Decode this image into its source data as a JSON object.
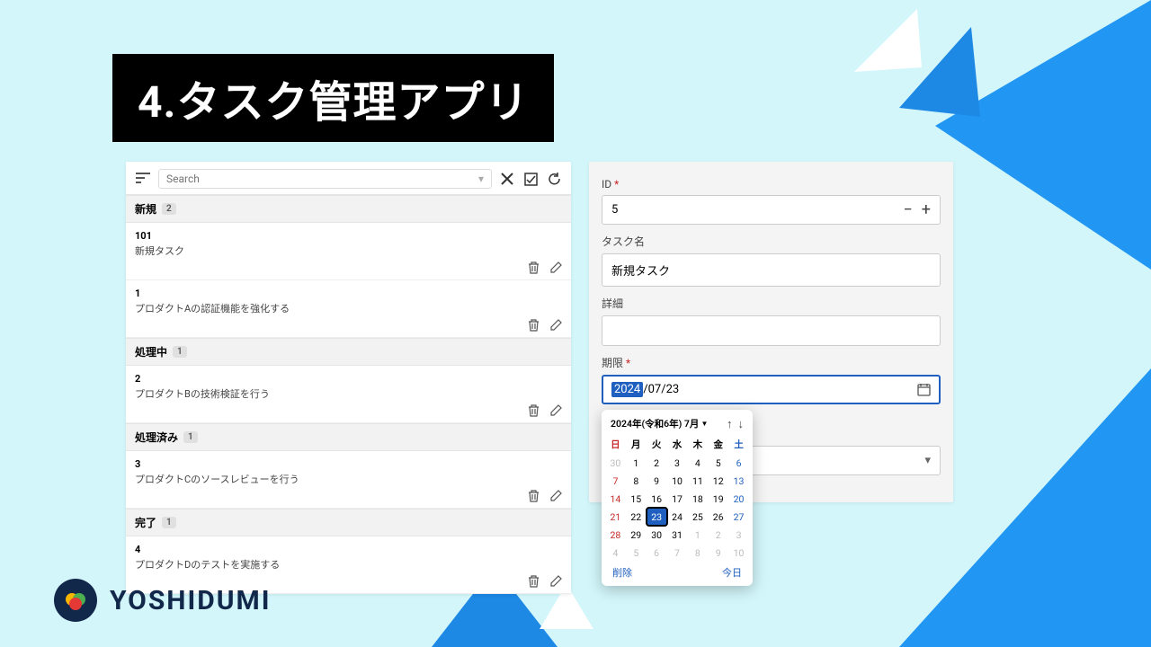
{
  "title": "4.タスク管理アプリ",
  "search_placeholder": "Search",
  "sections": [
    {
      "name": "新規",
      "count": "2",
      "tasks": [
        {
          "id": "101",
          "title": "新規タスク"
        },
        {
          "id": "1",
          "title": "プロダクトAの認証機能を強化する"
        }
      ]
    },
    {
      "name": "処理中",
      "count": "1",
      "tasks": [
        {
          "id": "2",
          "title": "プロダクトBの技術検証を行う"
        }
      ]
    },
    {
      "name": "処理済み",
      "count": "1",
      "tasks": [
        {
          "id": "3",
          "title": "プロダクトCのソースレビューを行う"
        }
      ]
    },
    {
      "name": "完了",
      "count": "1",
      "tasks": [
        {
          "id": "4",
          "title": "プロダクトDのテストを実施する"
        }
      ]
    }
  ],
  "form": {
    "id_label": "ID",
    "id_value": "5",
    "name_label": "タスク名",
    "name_value": "新規タスク",
    "detail_label": "詳細",
    "detail_value": "",
    "deadline_label": "期限",
    "deadline_year": "2024",
    "deadline_rest": "/07/23"
  },
  "datepicker": {
    "month_label": "2024年(令和6年) 7月",
    "dow": [
      "日",
      "月",
      "火",
      "水",
      "木",
      "金",
      "土"
    ],
    "rows": [
      [
        "30",
        "1",
        "2",
        "3",
        "4",
        "5",
        "6"
      ],
      [
        "7",
        "8",
        "9",
        "10",
        "11",
        "12",
        "13"
      ],
      [
        "14",
        "15",
        "16",
        "17",
        "18",
        "19",
        "20"
      ],
      [
        "21",
        "22",
        "23",
        "24",
        "25",
        "26",
        "27"
      ],
      [
        "28",
        "29",
        "30",
        "31",
        "1",
        "2",
        "3"
      ],
      [
        "4",
        "5",
        "6",
        "7",
        "8",
        "9",
        "10"
      ]
    ],
    "muted_before": 1,
    "muted_after_row": 4,
    "muted_after_col": 4,
    "selected": "23",
    "delete_label": "削除",
    "today_label": "今日"
  },
  "brand": "YOSHIDUMI"
}
